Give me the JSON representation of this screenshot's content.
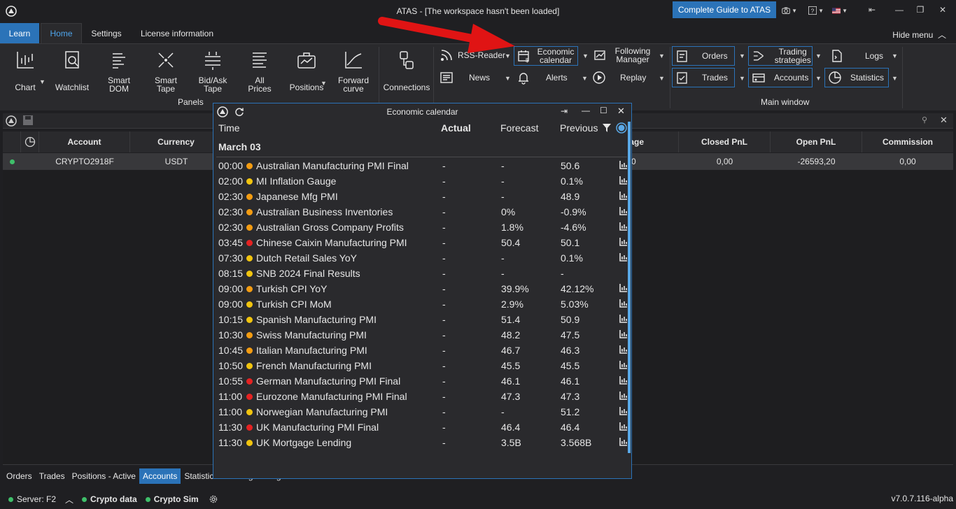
{
  "titlebar": {
    "title": "ATAS - [The workspace hasn't been loaded]",
    "guide_button": "Complete Guide to ATAS"
  },
  "ribbon_tabs": {
    "learn": "Learn",
    "home": "Home",
    "settings": "Settings",
    "license": "License information",
    "hide_menu": "Hide menu"
  },
  "panels": {
    "chart": "Chart",
    "watchlist": "Watchlist",
    "smart_dom": "Smart DOM",
    "smart_tape": "Smart Tape",
    "bid_ask_tape": "Bid/Ask Tape",
    "all_prices": "All Prices",
    "positions": "Positions",
    "forward_curve": "Forward curve",
    "connections": "Connections",
    "group_label": "Panels"
  },
  "tools": {
    "rss_reader": "RSS-Reader",
    "economic_calendar": "Economic calendar",
    "following_manager": "Following Manager",
    "news": "News",
    "alerts": "Alerts",
    "replay": "Replay"
  },
  "main_window": {
    "orders": "Orders",
    "trading_strategies": "Trading strategies",
    "logs": "Logs",
    "trades": "Trades",
    "accounts": "Accounts",
    "statistics": "Statistics",
    "group_label": "Main window"
  },
  "accounts_grid": {
    "headers": {
      "account": "Account",
      "currency": "Currency",
      "leverage": "erage",
      "closed_pnl": "Closed PnL",
      "open_pnl": "Open PnL",
      "commission": "Commission"
    },
    "row": {
      "account": "CRYPTO2918F",
      "currency": "USDT",
      "leverage": "0",
      "closed_pnl": "0,00",
      "open_pnl": "-26593,20",
      "commission": "0,00"
    }
  },
  "bottom_tabs": [
    "Orders",
    "Trades",
    "Positions - Active",
    "Accounts",
    "Statistics",
    "Trading strategies"
  ],
  "status": {
    "server": "Server: F2",
    "crypto_data": "Crypto data",
    "crypto_sim": "Crypto Sim",
    "version": "v7.0.7.116-alpha"
  },
  "econ": {
    "title": "Economic calendar",
    "headers": {
      "time": "Time",
      "actual": "Actual",
      "forecast": "Forecast",
      "previous": "Previous"
    },
    "date": "March 03",
    "importance_colors": {
      "high": "#e52222",
      "medium": "#f39c12",
      "low": "#f1c40f"
    },
    "events": [
      {
        "time": "00:00",
        "imp": "medium",
        "name": "Australian Manufacturing PMI Final",
        "actual": "-",
        "forecast": "-",
        "previous": "50.6",
        "chart": true
      },
      {
        "time": "02:00",
        "imp": "low",
        "name": "MI Inflation Gauge",
        "actual": "-",
        "forecast": "-",
        "previous": "0.1%",
        "chart": true
      },
      {
        "time": "02:30",
        "imp": "medium",
        "name": "Japanese Mfg PMI",
        "actual": "-",
        "forecast": "-",
        "previous": "48.9",
        "chart": true
      },
      {
        "time": "02:30",
        "imp": "medium",
        "name": "Australian Business Inventories",
        "actual": "-",
        "forecast": "0%",
        "previous": "-0.9%",
        "chart": true
      },
      {
        "time": "02:30",
        "imp": "medium",
        "name": "Australian Gross Company Profits",
        "actual": "-",
        "forecast": "1.8%",
        "previous": "-4.6%",
        "chart": true
      },
      {
        "time": "03:45",
        "imp": "high",
        "name": "Chinese Caixin Manufacturing PMI",
        "actual": "-",
        "forecast": "50.4",
        "previous": "50.1",
        "chart": true
      },
      {
        "time": "07:30",
        "imp": "low",
        "name": "Dutch Retail Sales YoY",
        "actual": "-",
        "forecast": "-",
        "previous": "0.1%",
        "chart": true
      },
      {
        "time": "08:15",
        "imp": "low",
        "name": "SNB 2024 Final Results",
        "actual": "-",
        "forecast": "-",
        "previous": "-",
        "chart": false
      },
      {
        "time": "09:00",
        "imp": "medium",
        "name": "Turkish CPI YoY",
        "actual": "-",
        "forecast": "39.9%",
        "previous": "42.12%",
        "chart": true
      },
      {
        "time": "09:00",
        "imp": "low",
        "name": "Turkish CPI MoM",
        "actual": "-",
        "forecast": "2.9%",
        "previous": "5.03%",
        "chart": true
      },
      {
        "time": "10:15",
        "imp": "low",
        "name": "Spanish Manufacturing PMI",
        "actual": "-",
        "forecast": "51.4",
        "previous": "50.9",
        "chart": true
      },
      {
        "time": "10:30",
        "imp": "medium",
        "name": "Swiss Manufacturing PMI",
        "actual": "-",
        "forecast": "48.2",
        "previous": "47.5",
        "chart": true
      },
      {
        "time": "10:45",
        "imp": "medium",
        "name": "Italian Manufacturing PMI",
        "actual": "-",
        "forecast": "46.7",
        "previous": "46.3",
        "chart": true
      },
      {
        "time": "10:50",
        "imp": "low",
        "name": "French Manufacturing PMI",
        "actual": "-",
        "forecast": "45.5",
        "previous": "45.5",
        "chart": true
      },
      {
        "time": "10:55",
        "imp": "high",
        "name": "German Manufacturing PMI Final",
        "actual": "-",
        "forecast": "46.1",
        "previous": "46.1",
        "chart": true
      },
      {
        "time": "11:00",
        "imp": "high",
        "name": "Eurozone Manufacturing PMI Final",
        "actual": "-",
        "forecast": "47.3",
        "previous": "47.3",
        "chart": true
      },
      {
        "time": "11:00",
        "imp": "low",
        "name": "Norwegian Manufacturing PMI",
        "actual": "-",
        "forecast": "-",
        "previous": "51.2",
        "chart": true
      },
      {
        "time": "11:30",
        "imp": "high",
        "name": "UK Manufacturing PMI Final",
        "actual": "-",
        "forecast": "46.4",
        "previous": "46.4",
        "chart": true
      },
      {
        "time": "11:30",
        "imp": "low",
        "name": "UK Mortgage Lending",
        "actual": "-",
        "forecast": "3.5B",
        "previous": "3.568B",
        "chart": true
      }
    ]
  }
}
